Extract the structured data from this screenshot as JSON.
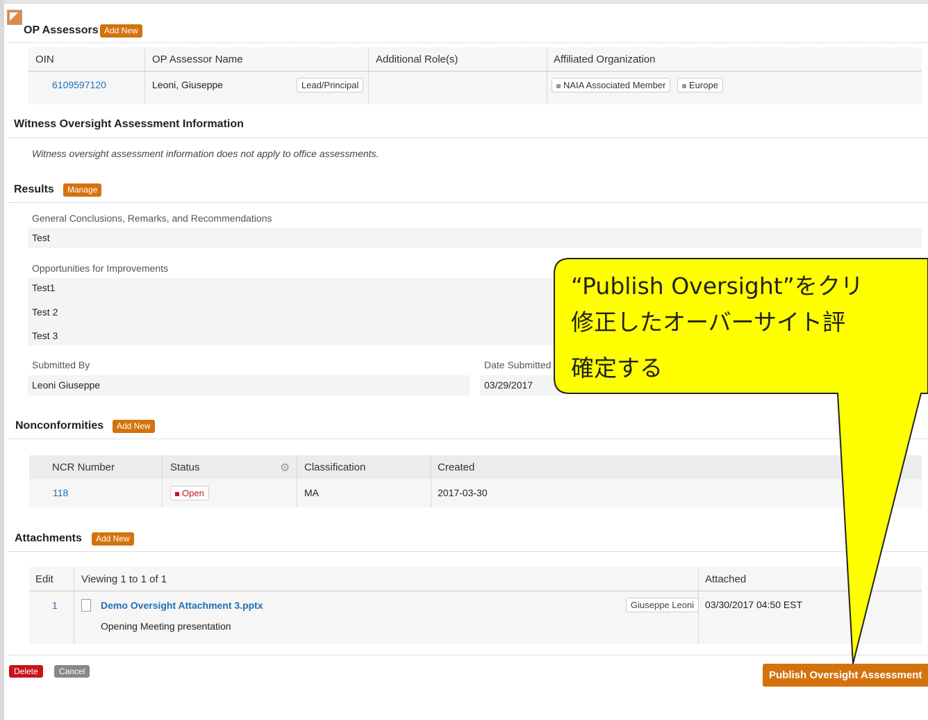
{
  "assessors": {
    "title": "OP Assessors",
    "add_label": "Add New",
    "columns": [
      "OIN",
      "OP Assessor Name",
      "Additional Role(s)",
      "Affiliated Organization"
    ],
    "row": {
      "oin": "6109597120",
      "name": "Leoni, Giuseppe",
      "role_tag": "Lead/Principal",
      "org_tags": [
        "NAIA Associated Member",
        "Europe"
      ]
    }
  },
  "witness": {
    "title": "Witness Oversight Assessment Information",
    "note": "Witness oversight assessment information does not apply to office assessments."
  },
  "results": {
    "title": "Results",
    "manage_label": "Manage",
    "conclusions_label": "General Conclusions, Remarks, and Recommendations",
    "conclusions_value": "Test",
    "ofi_label": "Opportunities for Improvements",
    "ofi_items": [
      "Test1",
      "Test 2",
      "Test 3"
    ],
    "submitted_by_label": "Submitted By",
    "submitted_by_value": "Leoni Giuseppe",
    "date_submitted_label": "Date Submitted",
    "date_submitted_value": "03/29/2017"
  },
  "nonconformities": {
    "title": "Nonconformities",
    "add_label": "Add New",
    "columns": [
      "NCR Number",
      "Status",
      "Classification",
      "Created"
    ],
    "row": {
      "ncr": "118",
      "status": "Open",
      "classification": "MA",
      "created": "2017-03-30"
    }
  },
  "attachments": {
    "title": "Attachments",
    "add_label": "Add New",
    "columns": {
      "edit": "Edit",
      "viewing": "Viewing 1 to 1 of 1",
      "attached": "Attached"
    },
    "row": {
      "edit": "1",
      "file": "Demo Oversight Attachment 3.pptx",
      "description": "Opening Meeting presentation",
      "user": "Giuseppe Leoni",
      "attached": "03/30/2017 04:50 EST"
    }
  },
  "footer": {
    "delete_label": "Delete",
    "cancel_label": "Cancel",
    "publish_label": "Publish Oversight Assessment"
  },
  "callout": {
    "line1": "“Publish Oversight”をクリ",
    "line2": "修正したオーバーサイト評",
    "line3": "確定する"
  },
  "colors": {
    "accent": "#d4720e",
    "danger": "#c8141a",
    "link": "#1e6fb5",
    "callout_fill": "#ffff00"
  }
}
